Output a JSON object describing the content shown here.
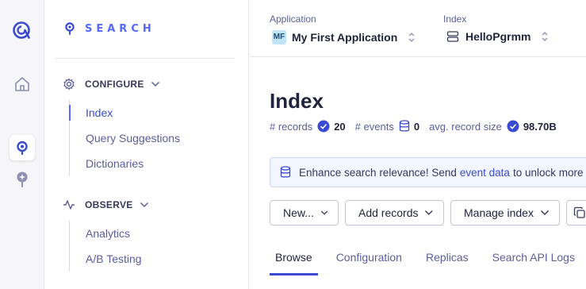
{
  "brand": {
    "label": "SEARCH"
  },
  "sidebar": {
    "configure": {
      "label": "CONFIGURE",
      "items": [
        {
          "label": "Index",
          "active": true
        },
        {
          "label": "Query Suggestions",
          "active": false
        },
        {
          "label": "Dictionaries",
          "active": false
        }
      ]
    },
    "observe": {
      "label": "OBSERVE",
      "items": [
        {
          "label": "Analytics"
        },
        {
          "label": "A/B Testing"
        }
      ]
    }
  },
  "topbar": {
    "application": {
      "label": "Application",
      "badge": "MF",
      "value": "My First Application"
    },
    "index": {
      "label": "Index",
      "value": "HelloPgrmm"
    }
  },
  "page": {
    "title": "Index",
    "stats": [
      {
        "key": "# records",
        "value": "20",
        "icon": "check-circle-icon"
      },
      {
        "key": "# events",
        "value": "0",
        "icon": "database-icon"
      },
      {
        "key": "avg. record size",
        "value": "98.70B",
        "icon": "check-circle-icon"
      }
    ]
  },
  "banner": {
    "text_before": "Enhance search relevance! Send",
    "link": "event data",
    "text_after": "to unlock more"
  },
  "actions": {
    "new_label": "New...",
    "add_records_label": "Add records",
    "manage_index_label": "Manage index"
  },
  "tabs": [
    {
      "label": "Browse",
      "active": true
    },
    {
      "label": "Configuration",
      "active": false
    },
    {
      "label": "Replicas",
      "active": false
    },
    {
      "label": "Search API Logs",
      "active": false
    }
  ],
  "colors": {
    "accent": "#5468ff",
    "link": "#3a4bd1",
    "rail_bg": "#f5f5fa"
  }
}
